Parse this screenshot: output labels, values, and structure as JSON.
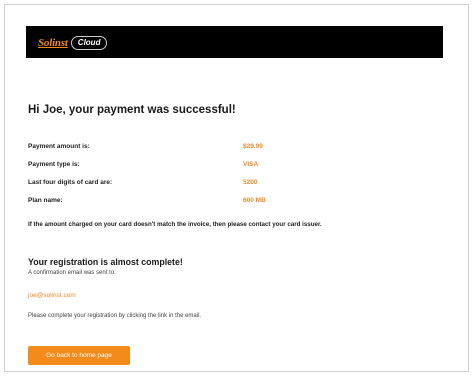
{
  "brand": {
    "logo_name": "Solinst",
    "cloud_label": "Cloud"
  },
  "heading": "Hi Joe, your payment was successful!",
  "payment": [
    {
      "label": "Payment amount is:",
      "value": "$29.99"
    },
    {
      "label": "Payment type is:",
      "value": "VISA"
    },
    {
      "label": "Last four digits of card are:",
      "value": "5200"
    },
    {
      "label": "Plan name:",
      "value": "600 MB"
    }
  ],
  "mismatch_note": "If the amount charged on your card doesn't match the invoice, then please contact your card issuer.",
  "registration": {
    "title": "Your registration is almost complete!",
    "sent_to": "A confirmation email was sent to:",
    "email": "joe@solinst.com",
    "instructions": "Please complete your registration by clicking the link in the email."
  },
  "home_button": "Go back to home page",
  "colors": {
    "accent": "#f38b1a",
    "banner": "#000000"
  }
}
